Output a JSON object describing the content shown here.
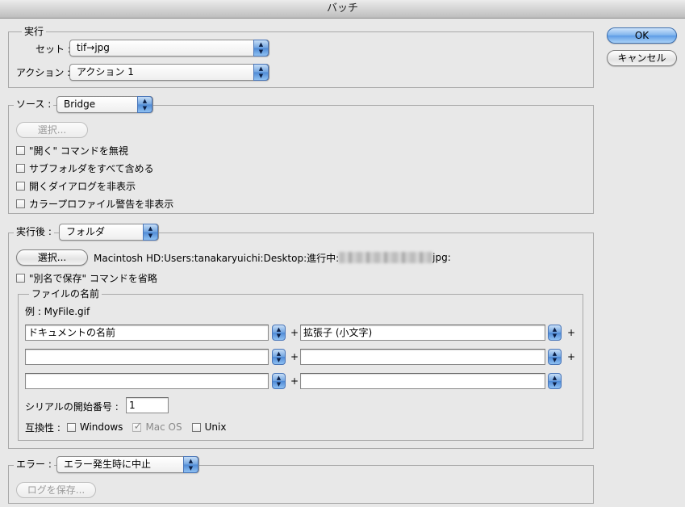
{
  "window": {
    "title": "バッチ"
  },
  "buttons": {
    "ok": "OK",
    "cancel": "キャンセル"
  },
  "run": {
    "label": "実行",
    "set_label": "セット :",
    "set_value": "tif→jpg",
    "action_label": "アクション :",
    "action_value": "アクション 1"
  },
  "source": {
    "label": "ソース :",
    "value": "Bridge",
    "choose_button": "選択...",
    "checkboxes": [
      {
        "label": "\"開く\" コマンドを無視",
        "checked": false
      },
      {
        "label": "サブフォルダをすべて含める",
        "checked": false
      },
      {
        "label": "開くダイアログを非表示",
        "checked": false
      },
      {
        "label": "カラープロファイル警告を非表示",
        "checked": false
      }
    ]
  },
  "destination": {
    "label": "実行後 :",
    "value": "フォルダ",
    "choose_button": "選択...",
    "path_prefix": "Macintosh HD:Users:tanakaryuichi:Desktop:進行中:",
    "path_suffix": "jpg:",
    "override_label": "\"別名で保存\" コマンドを省略"
  },
  "file_naming": {
    "label": "ファイルの名前",
    "example": "例 : MyFile.gif",
    "fields": [
      {
        "left": "ドキュメントの名前",
        "right": "拡張子 (小文字)"
      },
      {
        "left": "",
        "right": ""
      },
      {
        "left": "",
        "right": ""
      }
    ],
    "plus": "+",
    "serial_label": "シリアルの開始番号 :",
    "serial_value": "1",
    "compat_label": "互換性 :",
    "compat": [
      {
        "label": "Windows",
        "checked": false
      },
      {
        "label": "Mac OS",
        "checked": true
      },
      {
        "label": "Unix",
        "checked": false
      }
    ]
  },
  "errors": {
    "label": "エラー :",
    "value": "エラー発生時に中止",
    "save_log_button": "ログを保存..."
  }
}
